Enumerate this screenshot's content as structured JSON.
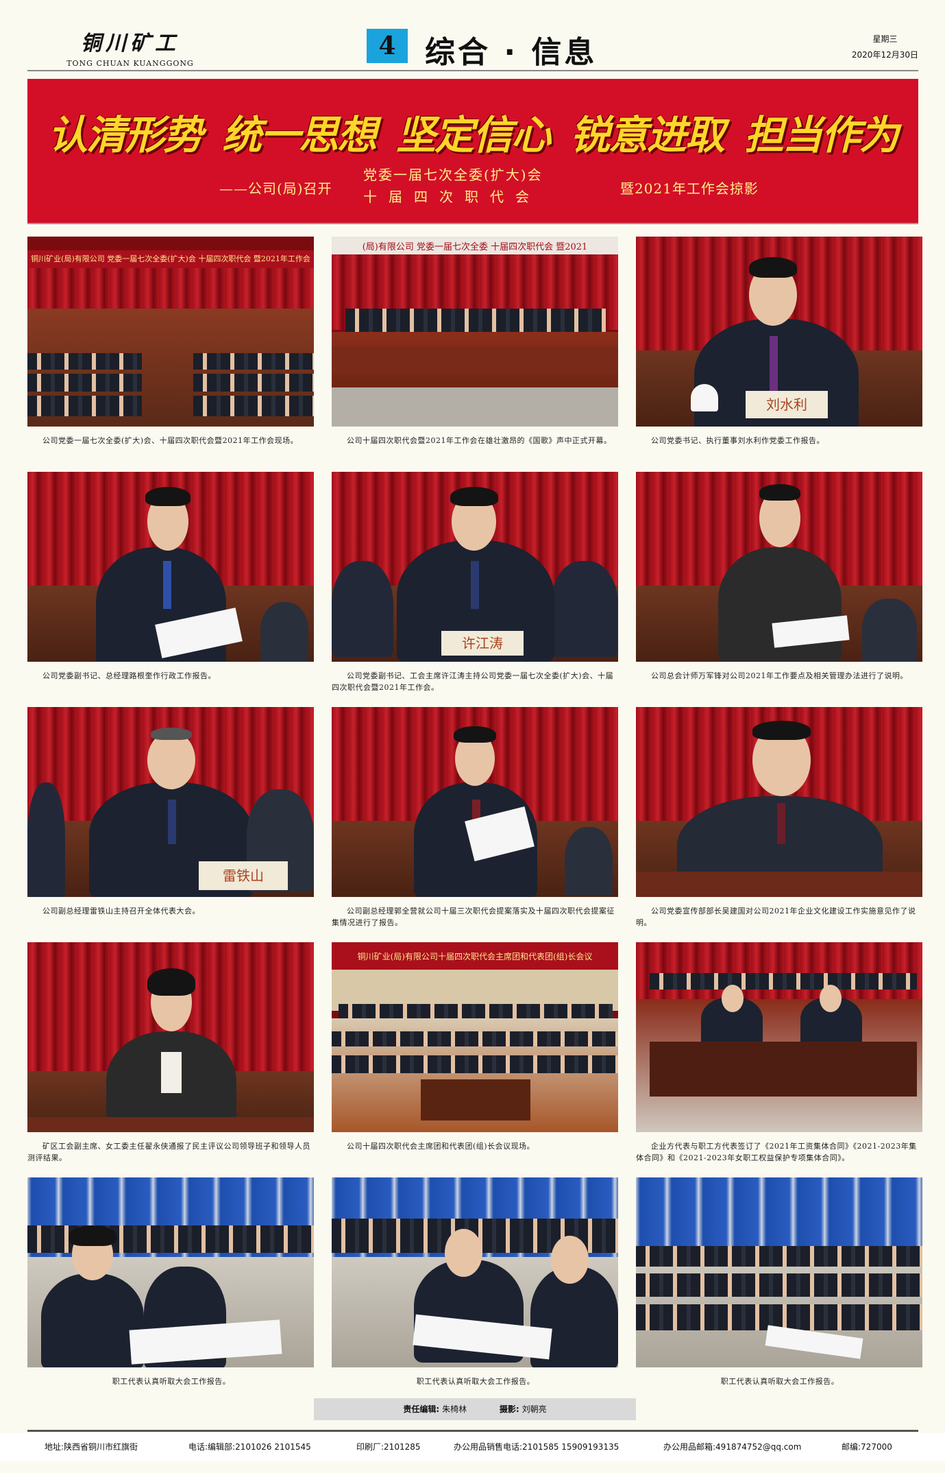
{
  "masthead": {
    "brand_cn": "铜川矿工",
    "brand_en": "TONG CHUAN KUANGGONG",
    "page_number": "4",
    "section": "综合 · 信息",
    "weekday": "星期三",
    "date": "2020年12月30日"
  },
  "banner": {
    "slogans": [
      "认清形势",
      "统一思想",
      "坚定信心",
      "锐意进取",
      "担当作为"
    ],
    "sub_prefix": "——公司(局)召开",
    "sub_line1": "党委一届七次全委(扩大)会",
    "sub_line2": "十届四次职代会",
    "sub_suffix": "暨2021年工作会掠影"
  },
  "photos": [
    {
      "caption": "公司党委一届七次全委(扩大)会、十届四次职代会暨2021年工作会现场。",
      "hall_text": "铜川矿业(局)有限公司 党委一届七次全委(扩大)会 十届四次职代会 暨2021年工作会"
    },
    {
      "caption": "公司十届四次职代会暨2021年工作会在雄壮激昂的《国歌》声中正式开幕。",
      "hall_text": "(局)有限公司 党委一届七次全委 十届四次职代会 暨2021"
    },
    {
      "caption": "公司党委书记、执行董事刘水利作党委工作报告。",
      "nameplate": "刘水利"
    },
    {
      "caption": "公司党委副书记、总经理路根奎作行政工作报告。"
    },
    {
      "caption": "公司党委副书记、工会主席许江涛主持公司党委一届七次全委(扩大)会、十届四次职代会暨2021年工作会。",
      "nameplate": "许江涛"
    },
    {
      "caption": "公司总会计师万军锋对公司2021年工作要点及相关管理办法进行了说明。"
    },
    {
      "caption": "公司副总经理雷铁山主持召开全体代表大会。",
      "nameplate": "雷铁山"
    },
    {
      "caption": "公司副总经理郭全营就公司十届三次职代会提案落实及十届四次职代会提案征集情况进行了报告。"
    },
    {
      "caption": "公司党委宣传部部长吴建国对公司2021年企业文化建设工作实施意见作了说明。"
    },
    {
      "caption": "矿区工会副主席、女工委主任翟永侠通报了民主评议公司领导班子和领导人员测评结果。"
    },
    {
      "caption": "公司十届四次职代会主席团和代表团(组)长会议现场。",
      "hall_text": "铜川矿业(局)有限公司十届四次职代会主席团和代表团(组)长会议"
    },
    {
      "caption": "企业方代表与职工方代表签订了《2021年工资集体合同》《2021-2023年集体合同》和《2021-2023年女职工权益保护专项集体合同》。"
    },
    {
      "caption": "职工代表认真听取大会工作报告。"
    },
    {
      "caption": "职工代表认真听取大会工作报告。"
    },
    {
      "caption": "职工代表认真听取大会工作报告。"
    }
  ],
  "credits": {
    "editor_label": "责任编辑:",
    "editor": "朱椅林",
    "photo_label": "摄影:",
    "photographer": "刘朝亮"
  },
  "footer": {
    "address": "地址:陕西省铜川市红旗街",
    "phone": "电话:编辑部:2101026  2101545",
    "printer": "印刷厂:2101285",
    "sales": "办公用品销售电话:2101585  15909193135",
    "email": "办公用品邮箱:491874752@qq.com",
    "postcode": "邮编:727000"
  }
}
